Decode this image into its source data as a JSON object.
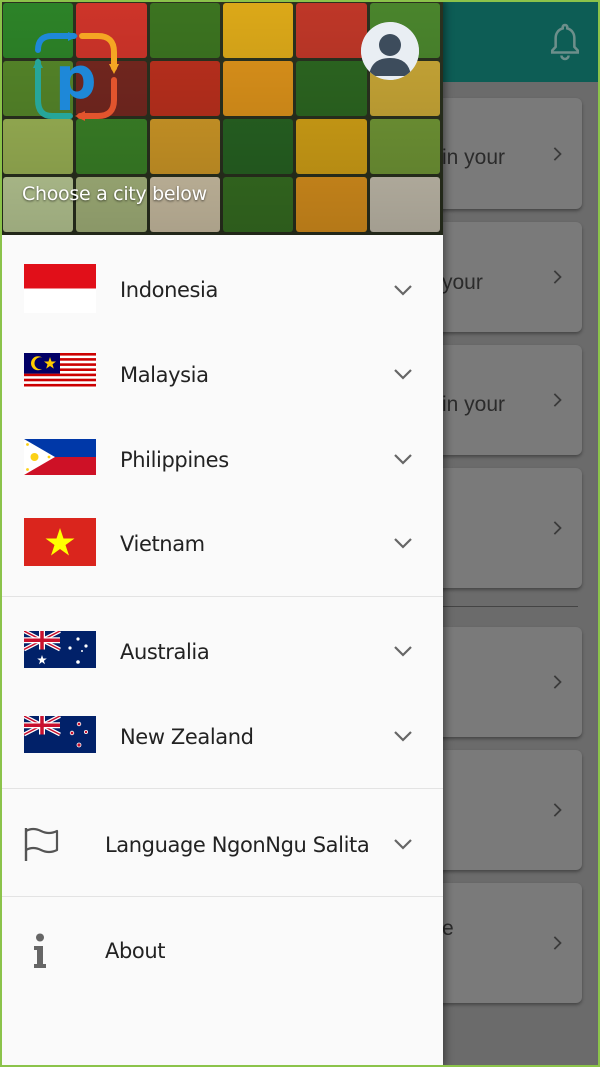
{
  "background_app": {
    "top_bar_color": "#0d5d55",
    "notification_icon": "bell-icon",
    "cards": [
      {
        "fragment": "in your"
      },
      {
        "fragment": "your"
      },
      {
        "fragment": "in your"
      },
      {
        "fragment": ""
      },
      {
        "fragment": ""
      },
      {
        "fragment": ""
      },
      {
        "fragment": "e"
      }
    ]
  },
  "drawer": {
    "header": {
      "caption": "Choose a city below",
      "logo_icon": "p-logo-icon",
      "avatar_icon": "user-avatar-icon"
    },
    "countries_asia": [
      {
        "label": "Indonesia",
        "flag": "indonesia-flag-icon"
      },
      {
        "label": "Malaysia",
        "flag": "malaysia-flag-icon"
      },
      {
        "label": "Philippines",
        "flag": "philippines-flag-icon"
      },
      {
        "label": "Vietnam",
        "flag": "vietnam-flag-icon"
      }
    ],
    "countries_oceania": [
      {
        "label": "Australia",
        "flag": "australia-flag-icon"
      },
      {
        "label": "New Zealand",
        "flag": "new-zealand-flag-icon"
      }
    ],
    "language": {
      "label": "Language NgonNgu Salita",
      "icon": "flag-outline-icon"
    },
    "about": {
      "label": "About",
      "icon": "info-icon"
    },
    "expand_icon": "chevron-down-icon"
  }
}
